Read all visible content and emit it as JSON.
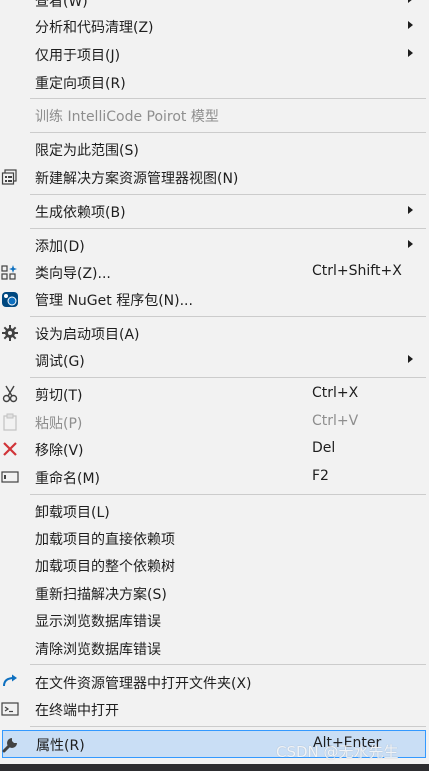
{
  "menu": {
    "items": [
      {
        "label": "查看(W)"
      },
      {
        "label": "分析和代码清理(Z)"
      },
      {
        "label": "仅用于项目(J)"
      },
      {
        "label": "重定向项目(R)"
      },
      {
        "label": "训练 IntelliCode Poirot 模型"
      },
      {
        "label": "限定为此范围(S)"
      },
      {
        "label": "新建解决方案资源管理器视图(N)"
      },
      {
        "label": "生成依赖项(B)"
      },
      {
        "label": "添加(D)"
      },
      {
        "label": "类向导(Z)...",
        "shortcut": "Ctrl+Shift+X"
      },
      {
        "label": "管理 NuGet 程序包(N)..."
      },
      {
        "label": "设为启动项目(A)"
      },
      {
        "label": "调试(G)"
      },
      {
        "label": "剪切(T)",
        "shortcut": "Ctrl+X"
      },
      {
        "label": "粘贴(P)",
        "shortcut": "Ctrl+V"
      },
      {
        "label": "移除(V)",
        "shortcut": "Del"
      },
      {
        "label": "重命名(M)",
        "shortcut": "F2"
      },
      {
        "label": "卸载项目(L)"
      },
      {
        "label": "加载项目的直接依赖项"
      },
      {
        "label": "加载项目的整个依赖树"
      },
      {
        "label": "重新扫描解决方案(S)"
      },
      {
        "label": "显示浏览数据库错误"
      },
      {
        "label": "清除浏览数据库错误"
      },
      {
        "label": "在文件资源管理器中打开文件夹(X)"
      },
      {
        "label": "在终端中打开"
      },
      {
        "label": "属性(R)",
        "shortcut": "Alt+Enter"
      }
    ]
  },
  "watermark": "CSDN @无水先生",
  "colors": {
    "menu_bg": "#f2f2f2",
    "highlight": "#c9def5",
    "disabled_text": "#8e8e8e",
    "delete_red": "#d13438",
    "nuget_blue": "#0e70c0"
  }
}
